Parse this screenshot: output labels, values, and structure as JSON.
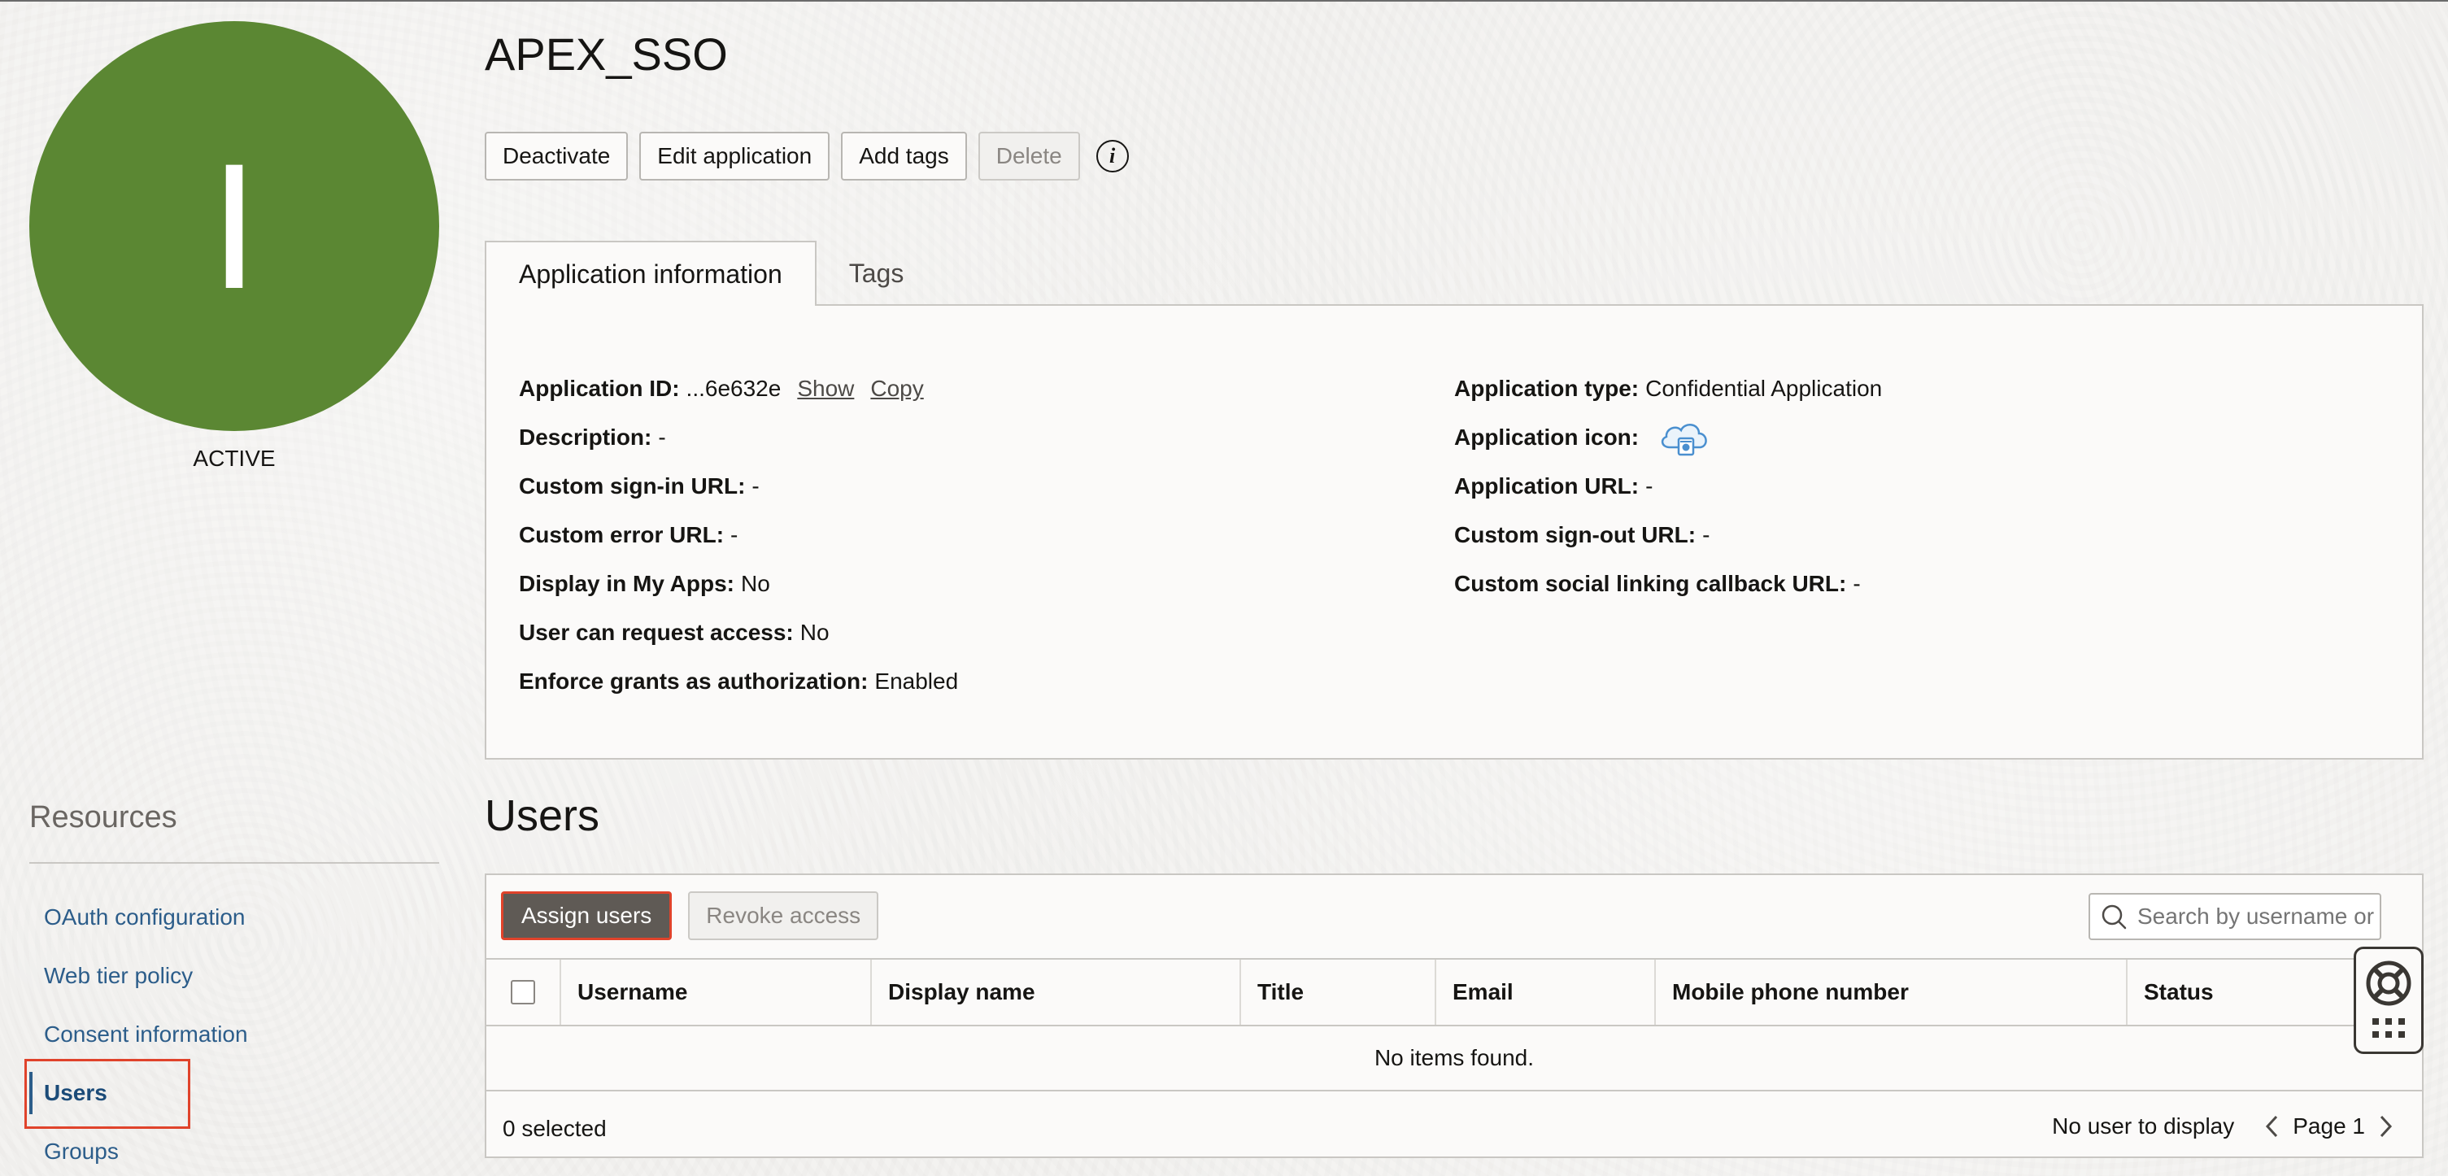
{
  "app": {
    "title": "APEX_SSO",
    "avatar_letter": "I",
    "avatar_color": "#5b8733",
    "status": "ACTIVE"
  },
  "actions": {
    "deactivate": "Deactivate",
    "edit": "Edit application",
    "add_tags": "Add tags",
    "delete": "Delete"
  },
  "tabs": [
    {
      "label": "Application information",
      "active": true
    },
    {
      "label": "Tags",
      "active": false
    }
  ],
  "info": {
    "left": [
      {
        "label": "Application ID:",
        "value": "...6e632e"
      },
      {
        "label": "Description:",
        "value": "-"
      },
      {
        "label": "Custom sign-in URL:",
        "value": "-"
      },
      {
        "label": "Custom error URL:",
        "value": "-"
      },
      {
        "label": "Display in My Apps:",
        "value": "No"
      },
      {
        "label": "User can request access:",
        "value": "No"
      },
      {
        "label": "Enforce grants as authorization:",
        "value": "Enabled"
      }
    ],
    "right": [
      {
        "label": "Application type:",
        "value": "Confidential Application"
      },
      {
        "label": "Application icon:",
        "value": ""
      },
      {
        "label": "Application URL:",
        "value": "-"
      },
      {
        "label": "Custom sign-out URL:",
        "value": "-"
      },
      {
        "label": "Custom social linking callback URL:",
        "value": "-"
      }
    ],
    "show_link": "Show",
    "copy_link": "Copy"
  },
  "resources": {
    "title": "Resources",
    "items": [
      {
        "label": "OAuth configuration",
        "active": false
      },
      {
        "label": "Web tier policy",
        "active": false
      },
      {
        "label": "Consent information",
        "active": false
      },
      {
        "label": "Users",
        "active": true
      },
      {
        "label": "Groups",
        "active": false
      }
    ]
  },
  "users": {
    "heading": "Users",
    "assign_button": "Assign users",
    "revoke_button": "Revoke access",
    "search_placeholder": "Search by username or email",
    "columns": [
      "Username",
      "Display name",
      "Title",
      "Email",
      "Mobile phone number",
      "Status"
    ],
    "empty_message": "No items found.",
    "selected_count": "0 selected",
    "no_user_text": "No user to display",
    "page_label": "Page 1"
  },
  "colors": {
    "accent_link": "#2c5d8a",
    "highlight": "#e0432b",
    "primary_button": "#5f5a55"
  }
}
